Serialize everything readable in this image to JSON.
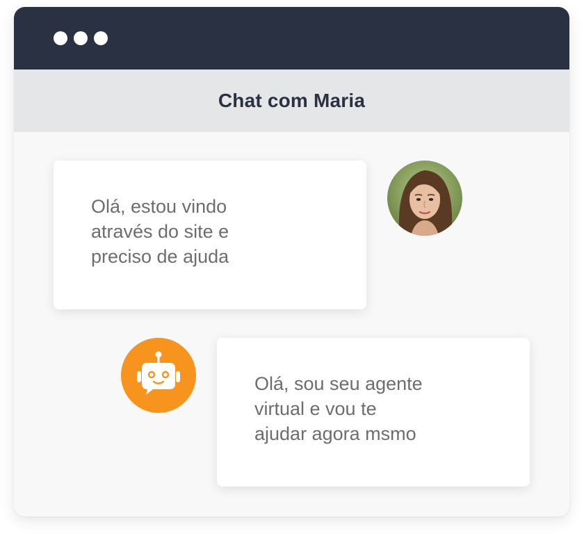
{
  "window": {
    "titlebar_color": "#2a3142",
    "controls": [
      "dot-icon",
      "dot-icon",
      "dot-icon"
    ]
  },
  "chat": {
    "title": "Chat com Maria",
    "messages": [
      {
        "sender": "user",
        "avatar_icon": "user-photo-avatar",
        "lines": [
          "Olá, estou vindo",
          "através do site e",
          "preciso de ajuda"
        ]
      },
      {
        "sender": "bot",
        "avatar_icon": "robot-icon",
        "avatar_color": "#f7941d",
        "lines": [
          "Olá, sou seu agente",
          "virtual e vou te",
          "ajudar agora msmo"
        ]
      }
    ]
  }
}
